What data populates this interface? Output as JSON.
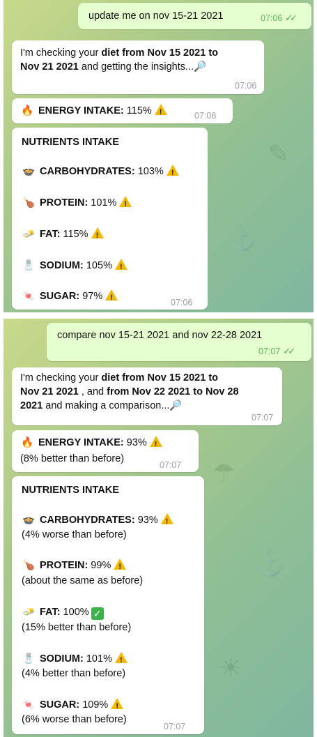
{
  "chat1": {
    "user_message": "update me on nov 15-21 2021",
    "user_time": "07:06",
    "checking_prefix": "I'm checking your ",
    "checking_bold": "diet from Nov 15 2021 to",
    "checking_bold2": "Nov 21 2021",
    "checking_suffix": " and getting the insights...",
    "checking_time": "07:06",
    "energy_label": "ENERGY INTAKE:",
    "energy_value": " 115%",
    "energy_time": "07:06",
    "nutrients_title": "NUTRIENTS INTAKE",
    "nutrients": [
      {
        "label": "CARBOHYDRATES:",
        "value": " 103%"
      },
      {
        "label": "PROTEIN:",
        "value": " 101%"
      },
      {
        "label": "FAT:",
        "value": " 115%"
      },
      {
        "label": "SODIUM:",
        "value": " 105%"
      },
      {
        "label": "SUGAR:",
        "value": " 97%"
      }
    ],
    "nutrients_time": "07:06"
  },
  "chat2": {
    "user_message": "compare nov 15-21 2021 and nov 22-28 2021",
    "user_time": "07:07",
    "checking_prefix": "I'm checking your ",
    "checking_bold1": "diet from Nov 15 2021 to",
    "checking_bold1b": "Nov 21 2021",
    "checking_mid": " , and ",
    "checking_bold2": "from Nov 22 2021 to Nov 28",
    "checking_bold2b": "2021",
    "checking_suffix": " and making a comparison...",
    "checking_time": "07:07",
    "energy_label": "ENERGY INTAKE:",
    "energy_value": " 93%",
    "energy_note": "(8% better than before)",
    "energy_time": "07:07",
    "nutrients_title": "NUTRIENTS INTAKE",
    "nutrients": [
      {
        "label": "CARBOHYDRATES:",
        "value": " 93%",
        "note": "(4% worse than before)"
      },
      {
        "label": "PROTEIN:",
        "value": " 99%",
        "note": "(about the same as before)"
      },
      {
        "label": "FAT:",
        "value": " 100%",
        "note": "(15% better than before)"
      },
      {
        "label": "SODIUM:",
        "value": " 101%",
        "note": "(4% better than before)"
      },
      {
        "label": "SUGAR:",
        "value": " 109%",
        "note": "(6% worse than before)"
      }
    ],
    "nutrients_time": "07:07"
  }
}
